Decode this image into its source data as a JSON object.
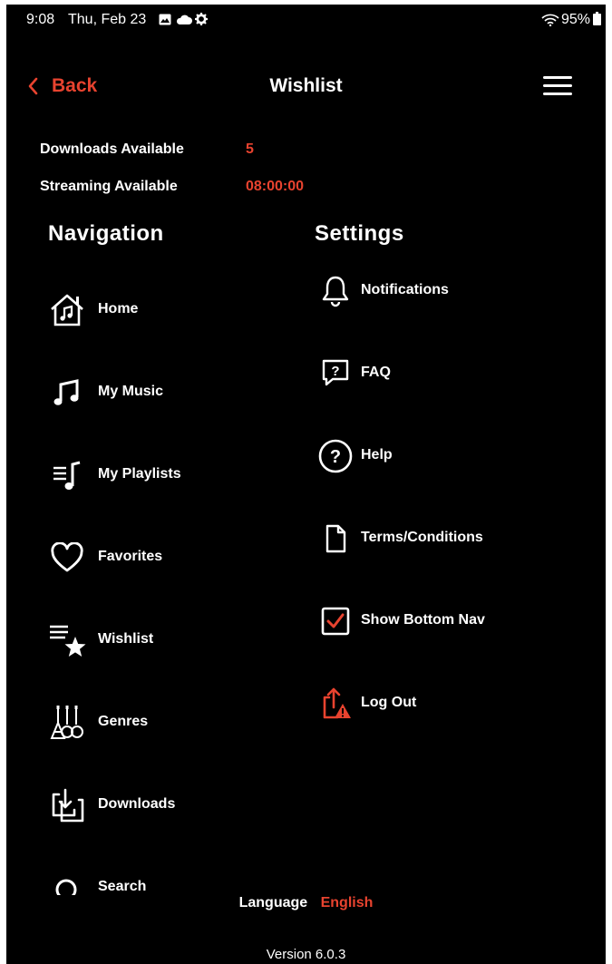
{
  "status_bar": {
    "time": "9:08",
    "date": "Thu, Feb 23",
    "battery": "95%"
  },
  "header": {
    "back_label": "Back",
    "title": "Wishlist"
  },
  "availability": {
    "downloads_label": "Downloads Available",
    "downloads_value": "5",
    "streaming_label": "Streaming Available",
    "streaming_value": "08:00:00"
  },
  "navigation": {
    "heading": "Navigation",
    "items": [
      {
        "label": "Home",
        "icon": "home-icon"
      },
      {
        "label": "My Music",
        "icon": "music-notes-icon"
      },
      {
        "label": "My Playlists",
        "icon": "playlist-icon"
      },
      {
        "label": "Favorites",
        "icon": "heart-icon"
      },
      {
        "label": "Wishlist",
        "icon": "wishlist-star-icon"
      },
      {
        "label": "Genres",
        "icon": "instruments-icon"
      },
      {
        "label": "Downloads",
        "icon": "download-icon"
      },
      {
        "label": "Search",
        "icon": "search-icon"
      }
    ]
  },
  "settings": {
    "heading": "Settings",
    "items": [
      {
        "label": "Notifications",
        "icon": "bell-icon"
      },
      {
        "label": "FAQ",
        "icon": "faq-bubble-icon"
      },
      {
        "label": "Help",
        "icon": "help-circle-icon"
      },
      {
        "label": "Terms/Conditions",
        "icon": "document-icon"
      },
      {
        "label": "Show Bottom Nav",
        "icon": "checkbox-icon"
      },
      {
        "label": "Log Out",
        "icon": "logout-icon"
      }
    ]
  },
  "footer": {
    "language_label": "Language",
    "language_value": "English",
    "version": "Version 6.0.3"
  },
  "colors": {
    "accent": "#e8432f",
    "background": "#000000",
    "text": "#ffffff"
  }
}
